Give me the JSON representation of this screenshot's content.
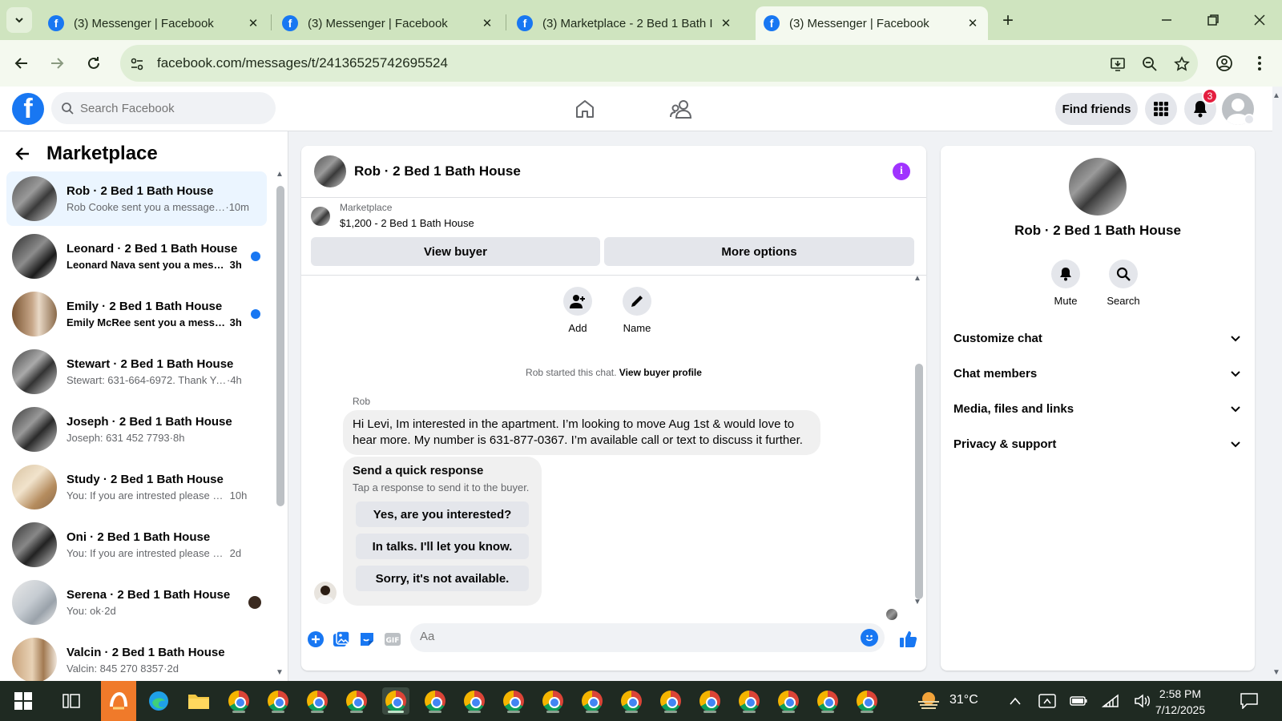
{
  "browser": {
    "tabs": [
      {
        "title": "(3) Messenger | Facebook",
        "active": false
      },
      {
        "title": "(3) Messenger | Facebook",
        "active": false
      },
      {
        "title": "(3) Marketplace - 2 Bed 1 Bath I",
        "active": false
      },
      {
        "title": "(3) Messenger | Facebook",
        "active": true
      }
    ],
    "url": "facebook.com/messages/t/24136525742695524"
  },
  "fb": {
    "logo": "f",
    "search_placeholder": "Search Facebook",
    "find_friends": "Find friends",
    "notification_count": "3"
  },
  "sidebar": {
    "title": "Marketplace",
    "conversations": [
      {
        "name": "Rob · 2 Bed 1 Bath House",
        "preview": "Rob Cooke sent you a message ...",
        "time": "·10m",
        "unread": false,
        "active": true
      },
      {
        "name": "Leonard · 2 Bed 1 Bath House",
        "preview": "Leonard Nava sent you a messa...",
        "time": "3h",
        "unread": true,
        "active": false
      },
      {
        "name": "Emily · 2 Bed 1 Bath House",
        "preview": "Emily McRee sent you a messa...",
        "time": "3h",
        "unread": true,
        "active": false
      },
      {
        "name": "Stewart · 2 Bed 1 Bath House",
        "preview": "Stewart: 631-664-6972. Thank You",
        "time": "·4h",
        "unread": false,
        "active": false
      },
      {
        "name": "Joseph · 2 Bed 1 Bath House",
        "preview": "Joseph: 631 452 7793",
        "time": "·8h",
        "unread": false,
        "active": false
      },
      {
        "name": "Study · 2 Bed 1 Bath House",
        "preview": "You: If you are intrested please se...",
        "time": "10h",
        "unread": false,
        "active": false
      },
      {
        "name": "Oni · 2 Bed 1 Bath House",
        "preview": "You: If you are intrested please sen...",
        "time": "2d",
        "unread": false,
        "active": false
      },
      {
        "name": "Serena · 2 Bed 1 Bath House",
        "preview": "You: ok",
        "time": "·2d",
        "unread": false,
        "active": false
      },
      {
        "name": "Valcin · 2 Bed 1 Bath House",
        "preview": "Valcin: 845 270 8357",
        "time": "·2d",
        "unread": false,
        "active": false
      }
    ]
  },
  "chat": {
    "title": "Rob · 2 Bed 1 Bath House",
    "listing_source": "Marketplace",
    "listing_title": "$1,200 - 2 Bed 1 Bath House",
    "view_buyer": "View buyer",
    "more_options": "More options",
    "add_label": "Add",
    "name_label": "Name",
    "system_text": "Rob started this chat.",
    "system_link": "View buyer profile",
    "sender": "Rob",
    "message": "Hi Levi, Im interested in the apartment. I’m looking to move Aug 1st & would love to hear more. My number is 631-877-0367. I’m available call or text to discuss it further.",
    "quick_title": "Send a quick response",
    "quick_sub": "Tap a response to send it to the buyer.",
    "quick_options": [
      "Yes, are you interested?",
      "In talks. I'll let you know.",
      "Sorry, it's not available."
    ],
    "composer_placeholder": "Aa"
  },
  "details": {
    "name": "Rob · 2 Bed 1 Bath House",
    "mute": "Mute",
    "search": "Search",
    "sections": [
      "Customize chat",
      "Chat members",
      "Media, files and links",
      "Privacy & support"
    ]
  },
  "taskbar": {
    "weather": "31°C",
    "time": "2:58 PM",
    "date": "7/12/2025"
  },
  "colors": {
    "facebook_blue": "#1877f2",
    "info_purple": "#a033ff",
    "notification_red": "#e41e3f"
  }
}
